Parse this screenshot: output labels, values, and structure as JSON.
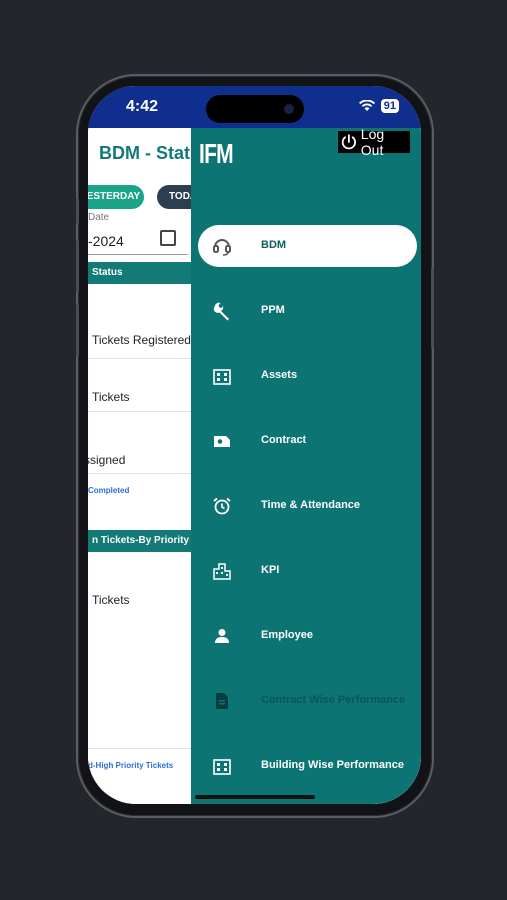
{
  "status_bar": {
    "time": "4:42",
    "battery": "91"
  },
  "background_screen": {
    "title": "BDM - Status",
    "filters": {
      "yesterday": "YESTERDAY",
      "today": "TODAY"
    },
    "date_label": "Date",
    "date_value": "-2024",
    "section_status": "Status",
    "rows": [
      "Tickets Registered",
      "Tickets",
      "ssigned"
    ],
    "completed_link": "Completed",
    "section_priority": "n Tickets-By Priority",
    "priority_row": "Tickets",
    "high_priority_link": "d-High Priority Tickets"
  },
  "drawer": {
    "logo": "IFM",
    "logout_label": "Log Out",
    "items": [
      {
        "label": "BDM",
        "icon": "headset-icon",
        "active": true
      },
      {
        "label": "PPM",
        "icon": "wrench-icon"
      },
      {
        "label": "Assets",
        "icon": "building-icon"
      },
      {
        "label": "Contract",
        "icon": "document-card-icon"
      },
      {
        "label": "Time & Attendance",
        "icon": "alarm-clock-icon"
      },
      {
        "label": "KPI",
        "icon": "city-icon"
      },
      {
        "label": "Employee",
        "icon": "person-icon"
      },
      {
        "label": "Contract Wise Performance",
        "icon": "report-icon",
        "dim": true
      },
      {
        "label": "Building Wise Performance",
        "icon": "building-icon"
      }
    ]
  },
  "colors": {
    "drawer": "#0d7474",
    "status_bar": "#0f2e8e",
    "accent": "#1aa58a"
  }
}
